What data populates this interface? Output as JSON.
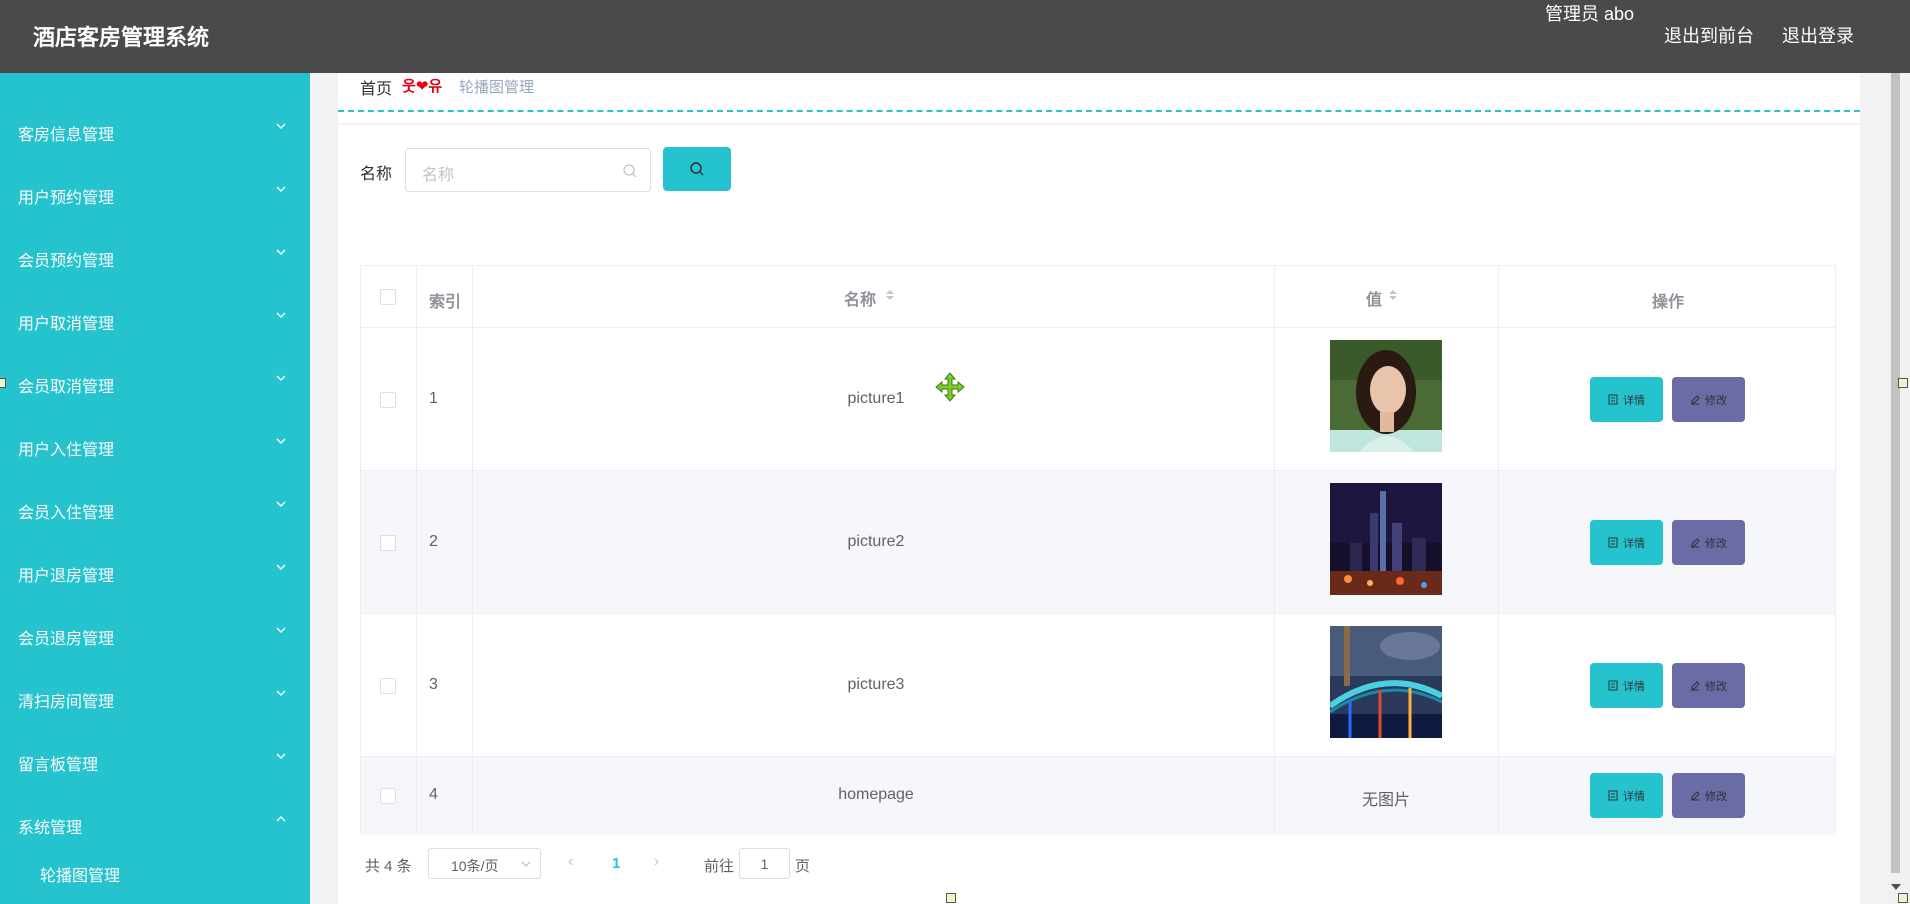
{
  "header": {
    "title": "酒店客房管理系统",
    "admin_prefix": "管理员",
    "admin_name": "abo",
    "back_to_front": "退出到前台",
    "logout": "退出登录"
  },
  "sidebar": {
    "items": [
      {
        "label": "客房信息管理"
      },
      {
        "label": "用户预约管理"
      },
      {
        "label": "会员预约管理"
      },
      {
        "label": "用户取消管理"
      },
      {
        "label": "会员取消管理"
      },
      {
        "label": "用户入住管理"
      },
      {
        "label": "会员入住管理"
      },
      {
        "label": "用户退房管理"
      },
      {
        "label": "会员退房管理"
      },
      {
        "label": "清扫房间管理"
      },
      {
        "label": "留言板管理"
      },
      {
        "label": "系统管理"
      }
    ],
    "submenu": [
      "轮播图管理"
    ]
  },
  "breadcrumb": {
    "home": "首页",
    "separator": "웃❤유",
    "current": "轮播图管理"
  },
  "search": {
    "label": "名称",
    "placeholder": "名称"
  },
  "table": {
    "columns": [
      "索引",
      "名称",
      "值",
      "操作"
    ],
    "rows": [
      {
        "index": "1",
        "name": "picture1",
        "value": "",
        "image": "woman-portrait"
      },
      {
        "index": "2",
        "name": "picture2",
        "value": "",
        "image": "city-night"
      },
      {
        "index": "3",
        "name": "picture3",
        "value": "",
        "image": "bridge-night"
      },
      {
        "index": "4",
        "name": "homepage",
        "value": "无图片",
        "image": ""
      }
    ],
    "detail_label": "详情",
    "edit_label": "修改"
  },
  "pagination": {
    "total": "共 4 条",
    "page_size": "10条/页",
    "current_page": "1",
    "goto_prefix": "前往",
    "goto_value": "1",
    "goto_suffix": "页"
  },
  "colors": {
    "accent": "#24c3cd",
    "header": "#4a4a4a",
    "edit": "#6b6ba6"
  }
}
